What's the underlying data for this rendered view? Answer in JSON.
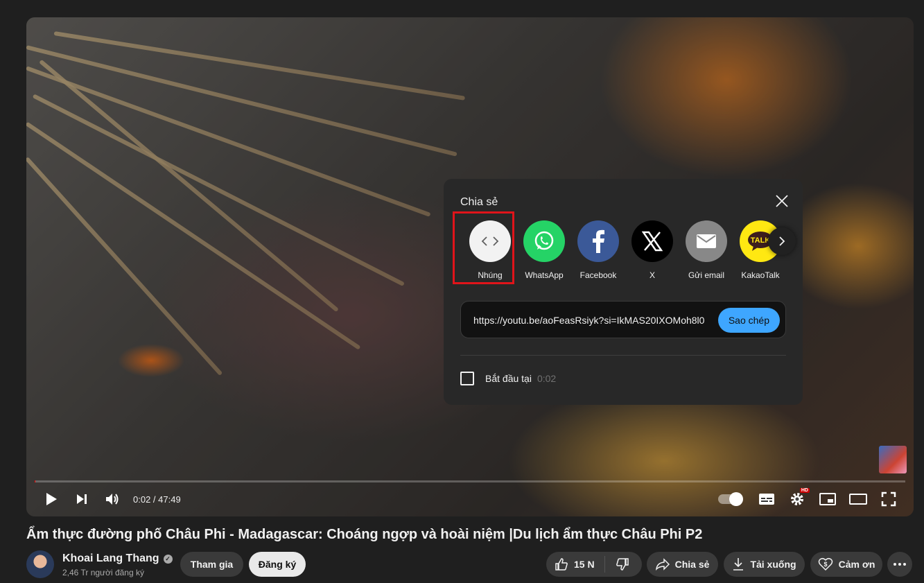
{
  "player": {
    "time_current": "0:02",
    "time_separator": " / ",
    "time_total": "47:49",
    "progress_fraction": 0.0007,
    "hd_badge": "HD"
  },
  "share_dialog": {
    "title": "Chia sẻ",
    "targets": [
      {
        "label": "Nhúng",
        "icon": "embed-code-icon"
      },
      {
        "label": "WhatsApp",
        "icon": "whatsapp-icon",
        "color": "#25d366"
      },
      {
        "label": "Facebook",
        "icon": "facebook-icon",
        "color": "#3b5998"
      },
      {
        "label": "X",
        "icon": "x-icon",
        "color": "#000000"
      },
      {
        "label": "Gửi email",
        "icon": "email-icon",
        "color": "#888888"
      },
      {
        "label": "KakaoTalk",
        "icon": "kakaotalk-icon",
        "color": "#ffe812"
      }
    ],
    "kakao_badge": "TALK",
    "url": "https://youtu.be/aoFeasRsiyk?si=IkMAS20IXOMoh8l0",
    "copy_label": "Sao chép",
    "start_at_label": "Bắt đầu tại",
    "start_at_time": "0:02"
  },
  "video": {
    "title": "Ẩm thực đường phố Châu Phi - Madagascar: Choáng ngợp và hoài niệm |Du lịch ẩm thực Châu Phi P2"
  },
  "channel": {
    "name": "Khoai Lang Thang",
    "subscribers": "2,46 Tr người đăng ký",
    "join_label": "Tham gia",
    "subscribe_label": "Đăng ký"
  },
  "actions": {
    "like_count": "15 N",
    "share_label": "Chia sẻ",
    "download_label": "Tải xuống",
    "thanks_label": "Cảm ơn"
  },
  "colors": {
    "accent_blue": "#3ea6ff",
    "highlight_red": "#e0141a",
    "progress_red": "#ff0000"
  }
}
